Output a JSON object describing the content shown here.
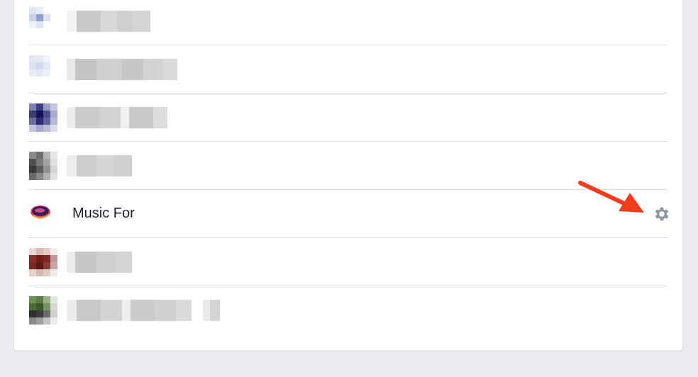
{
  "apps": [
    {
      "name": "",
      "redacted": true,
      "icon": "pixelated-app-icon"
    },
    {
      "name": "",
      "redacted": true,
      "icon": "pixelated-app-icon"
    },
    {
      "name": "",
      "redacted": true,
      "icon": "pixelated-app-icon"
    },
    {
      "name": "",
      "redacted": true,
      "icon": "pixelated-app-icon"
    },
    {
      "name": "Music For",
      "redacted": false,
      "icon": "music-app-icon",
      "settings_icon": "gear-icon"
    },
    {
      "name": "",
      "redacted": true,
      "icon": "pixelated-app-icon"
    },
    {
      "name": "",
      "redacted": true,
      "icon": "pixelated-app-icon"
    }
  ],
  "annotation": {
    "icon": "red-arrow-icon",
    "color": "#f23c1e"
  },
  "colors": {
    "background": "#e9ebee",
    "card": "#ffffff",
    "divider": "#dadde1",
    "gear": "#9197a3"
  }
}
